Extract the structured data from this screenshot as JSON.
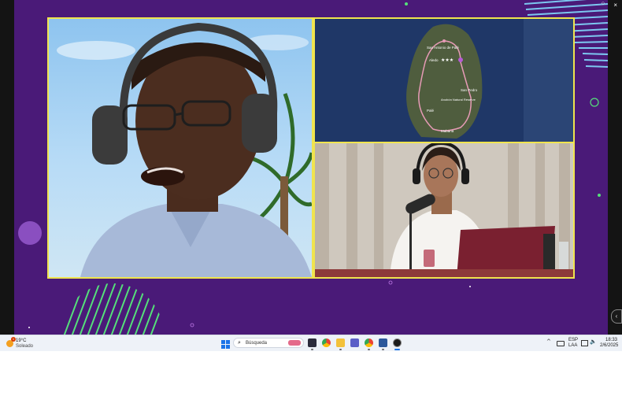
{
  "window": {
    "close_glyph": "×",
    "top_indicator_glyph": "○"
  },
  "panels": {
    "speaker_left": {
      "description_icon": "person-headphones-icon"
    },
    "map": {
      "labels": [
        "San Antonio de Palé",
        "Aledo",
        "San Pedro",
        "Mabana",
        "Anobón Natural Reserve",
        "Palé"
      ],
      "stars": "★★★"
    },
    "studio": {
      "description_icon": "host-microphone-icon"
    }
  },
  "taskbar": {
    "weather": {
      "temp": "19°C",
      "condition": "Soleado",
      "badge": "1"
    },
    "search": {
      "placeholder": "Búsqueda"
    },
    "language": {
      "line1": "ESP",
      "line2": "LAA"
    },
    "clock": {
      "time": "18:33",
      "date": "2/6/2025"
    },
    "scroll_button": "‹"
  },
  "colors": {
    "frame": "#f0e44e",
    "background": "#4a1a78",
    "accent_green": "#55e07a"
  }
}
